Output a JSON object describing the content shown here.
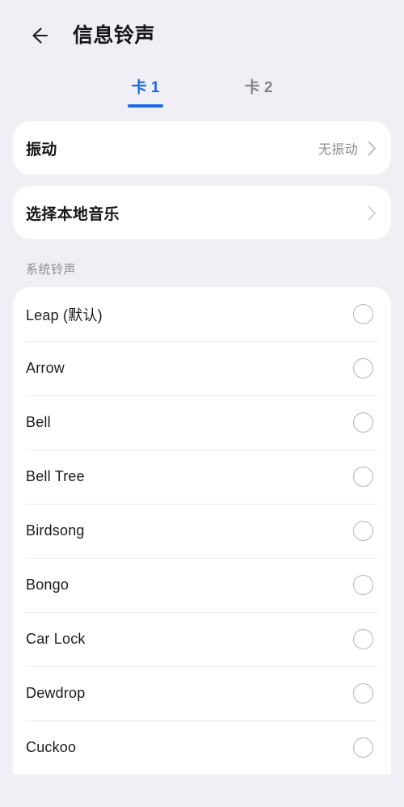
{
  "header": {
    "back_icon": "arrow-left-icon",
    "title": "信息铃声"
  },
  "tabs": [
    {
      "label": "卡 1",
      "active": true
    },
    {
      "label": "卡 2",
      "active": false
    }
  ],
  "settings": [
    {
      "label": "振动",
      "value": "无振动",
      "chevron_icon": "chevron-right-icon"
    },
    {
      "label": "选择本地音乐",
      "value": "",
      "chevron_icon": "chevron-right-icon"
    }
  ],
  "section": {
    "title": "系统铃声"
  },
  "ringtones": [
    {
      "label": "Leap (默认)",
      "selected": false
    },
    {
      "label": "Arrow",
      "selected": false
    },
    {
      "label": "Bell",
      "selected": false
    },
    {
      "label": "Bell Tree",
      "selected": false
    },
    {
      "label": "Birdsong",
      "selected": false
    },
    {
      "label": "Bongo",
      "selected": false
    },
    {
      "label": "Car Lock",
      "selected": false
    },
    {
      "label": "Dewdrop",
      "selected": false
    },
    {
      "label": "Cuckoo",
      "selected": false
    }
  ],
  "colors": {
    "background": "#f0eff5",
    "card": "#ffffff",
    "accent": "#1b6ae0",
    "primary_text": "#15161a",
    "secondary_text": "#8c8c92",
    "divider": "#ececf0",
    "radio_border": "#b4b4ba"
  }
}
